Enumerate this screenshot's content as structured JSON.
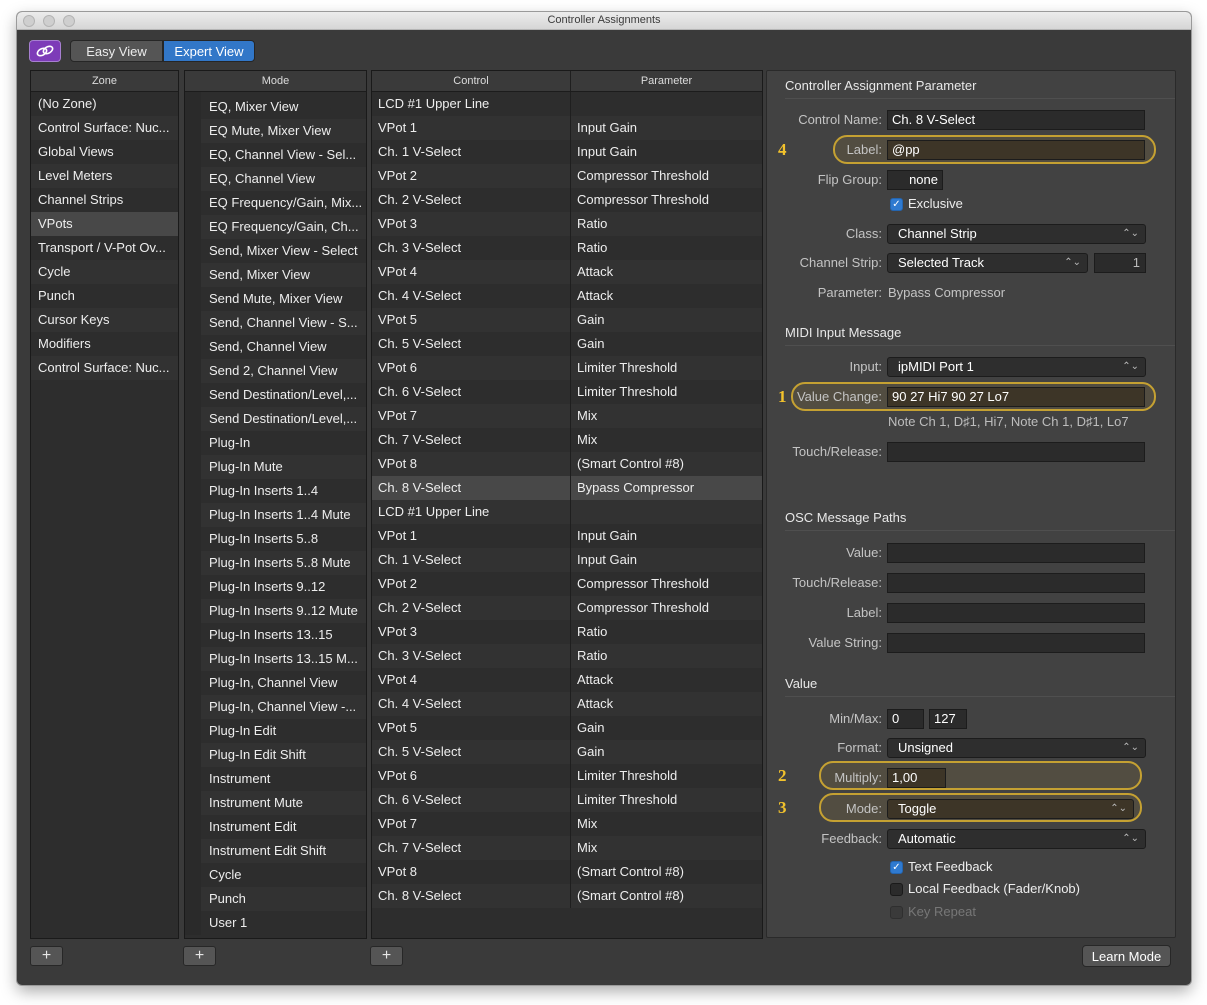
{
  "window": {
    "title": "Controller Assignments"
  },
  "toolbar": {
    "easy_view": "Easy View",
    "expert_view": "Expert View"
  },
  "zone": {
    "header": "Zone",
    "items": [
      "(No Zone)",
      "Control Surface: Nuc...",
      "Global Views",
      "Level Meters",
      "Channel Strips",
      "VPots",
      "Transport / V-Pot Ov...",
      "Cycle",
      "Punch",
      "Cursor Keys",
      "Modifiers",
      "Control Surface: Nuc..."
    ],
    "selected_index": 5
  },
  "mode": {
    "header": "Mode",
    "items": [
      "EQ, Mixer View",
      "EQ Mute, Mixer View",
      "EQ, Channel View - Sel...",
      "EQ, Channel View",
      "EQ Frequency/Gain, Mix...",
      "EQ Frequency/Gain, Ch...",
      "Send, Mixer View - Select",
      "Send, Mixer View",
      "Send Mute, Mixer View",
      "Send, Channel View - S...",
      "Send, Channel View",
      "Send 2, Channel View",
      "Send Destination/Level,...",
      "Send Destination/Level,...",
      "Plug-In",
      "Plug-In Mute",
      "Plug-In Inserts 1..4",
      "Plug-In Inserts 1..4 Mute",
      "Plug-In Inserts 5..8",
      "Plug-In Inserts 5..8 Mute",
      "Plug-In Inserts 9..12",
      "Plug-In Inserts 9..12 Mute",
      "Plug-In Inserts 13..15",
      "Plug-In Inserts 13..15 M...",
      "Plug-In, Channel View",
      "Plug-In, Channel View -...",
      "Plug-In Edit",
      "Plug-In Edit Shift",
      "Instrument",
      "Instrument Mute",
      "Instrument Edit",
      "Instrument Edit Shift",
      "Cycle",
      "Punch",
      "User 1"
    ]
  },
  "control_table": {
    "headers": [
      "Control",
      "Parameter"
    ],
    "rows": [
      [
        "LCD #1 Upper Line",
        ""
      ],
      [
        "VPot  1",
        "Input Gain"
      ],
      [
        "Ch. 1 V-Select",
        "Input Gain"
      ],
      [
        "VPot  2",
        "Compressor Threshold"
      ],
      [
        "Ch. 2 V-Select",
        "Compressor Threshold"
      ],
      [
        "VPot  3",
        "Ratio"
      ],
      [
        "Ch. 3 V-Select",
        "Ratio"
      ],
      [
        "VPot  4",
        "Attack"
      ],
      [
        "Ch. 4 V-Select",
        "Attack"
      ],
      [
        "VPot  5",
        "Gain"
      ],
      [
        "Ch. 5 V-Select",
        "Gain"
      ],
      [
        "VPot  6",
        "Limiter Threshold"
      ],
      [
        "Ch. 6 V-Select",
        "Limiter Threshold"
      ],
      [
        "VPot  7",
        "Mix"
      ],
      [
        "Ch. 7 V-Select",
        "Mix"
      ],
      [
        "VPot  8",
        "(Smart Control #8)"
      ],
      [
        "Ch. 8 V-Select",
        "Bypass Compressor"
      ],
      [
        "LCD #1 Upper Line",
        ""
      ],
      [
        "VPot  1",
        "Input Gain"
      ],
      [
        "Ch. 1 V-Select",
        "Input Gain"
      ],
      [
        "VPot  2",
        "Compressor Threshold"
      ],
      [
        "Ch. 2 V-Select",
        "Compressor Threshold"
      ],
      [
        "VPot  3",
        "Ratio"
      ],
      [
        "Ch. 3 V-Select",
        "Ratio"
      ],
      [
        "VPot  4",
        "Attack"
      ],
      [
        "Ch. 4 V-Select",
        "Attack"
      ],
      [
        "VPot  5",
        "Gain"
      ],
      [
        "Ch. 5 V-Select",
        "Gain"
      ],
      [
        "VPot  6",
        "Limiter Threshold"
      ],
      [
        "Ch. 6 V-Select",
        "Limiter Threshold"
      ],
      [
        "VPot  7",
        "Mix"
      ],
      [
        "Ch. 7 V-Select",
        "Mix"
      ],
      [
        "VPot  8",
        "(Smart Control #8)"
      ],
      [
        "Ch. 8 V-Select",
        "(Smart Control #8)"
      ]
    ],
    "selected_index": 16
  },
  "inspector": {
    "section_assignment": "Controller Assignment Parameter",
    "control_name_label": "Control Name:",
    "control_name_value": "Ch. 8 V-Select",
    "label_label": "Label:",
    "label_value": "@pp",
    "flip_group_label": "Flip Group:",
    "flip_group_value": "none",
    "exclusive_label": "Exclusive",
    "class_label": "Class:",
    "class_value": "Channel Strip",
    "channel_strip_label": "Channel Strip:",
    "channel_strip_value": "Selected Track",
    "channel_strip_number": "1",
    "parameter_label": "Parameter:",
    "parameter_value": "Bypass Compressor",
    "section_midi": "MIDI Input Message",
    "input_label": "Input:",
    "input_value": "ipMIDI Port 1",
    "value_change_label": "Value Change:",
    "value_change_value": "90 27 Hi7 90 27 Lo7",
    "value_change_desc": "Note Ch 1, D♯1, Hi7, Note Ch 1, D♯1, Lo7",
    "touch_release_label": "Touch/Release:",
    "section_osc": "OSC Message Paths",
    "osc_value_label": "Value:",
    "osc_touch_label": "Touch/Release:",
    "osc_label_label": "Label:",
    "osc_value_string_label": "Value String:",
    "section_value": "Value",
    "minmax_label": "Min/Max:",
    "min_value": "0",
    "max_value": "127",
    "format_label": "Format:",
    "format_value": "Unsigned",
    "multiply_label": "Multiply:",
    "multiply_value": "1,00",
    "mode_label": "Mode:",
    "mode_value": "Toggle",
    "feedback_label": "Feedback:",
    "feedback_value": "Automatic",
    "text_feedback_label": "Text Feedback",
    "local_feedback_label": "Local Feedback (Fader/Knob)",
    "key_repeat_label": "Key Repeat"
  },
  "markers": {
    "m1": "1",
    "m2": "2",
    "m3": "3",
    "m4": "4"
  },
  "buttons": {
    "add": "+",
    "learn_mode": "Learn Mode"
  },
  "colors": {
    "accent_blue": "#3277c8",
    "link_purple": "#7d3bb8",
    "highlight_gold": "#c5a132",
    "marker_yellow": "#f2c22c"
  }
}
